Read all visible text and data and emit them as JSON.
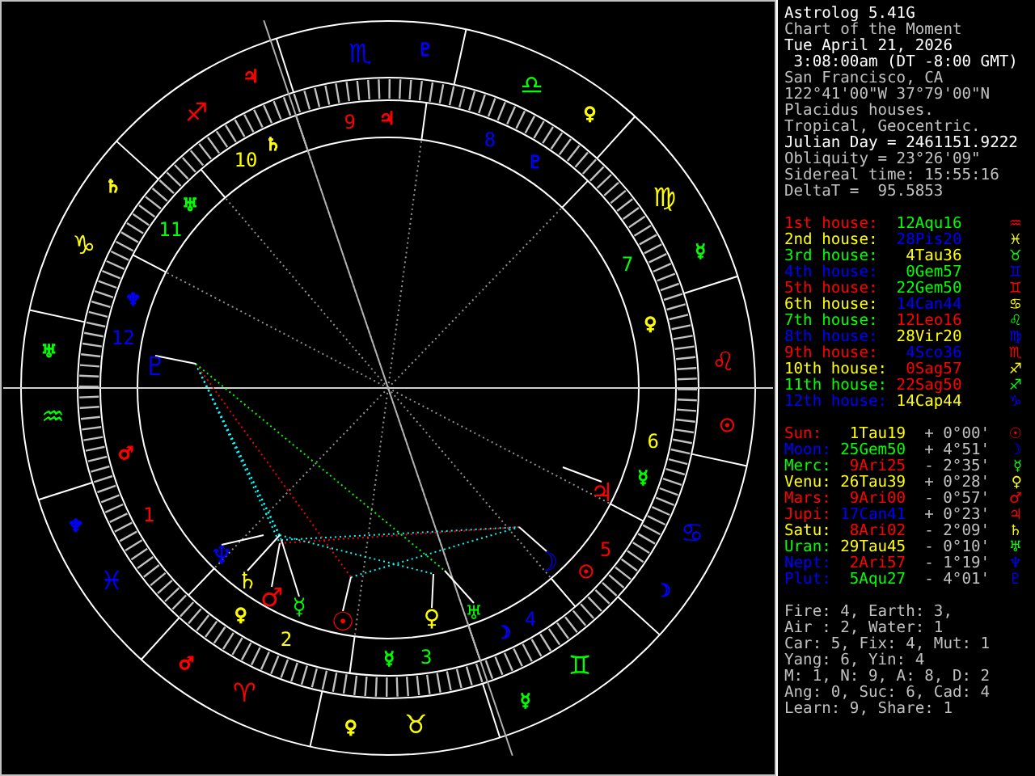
{
  "chart": {
    "signs": [
      {
        "glyph": "♈",
        "color": "#ff0000",
        "ruler": {
          "glyph": "♂",
          "color": "#ff0000"
        }
      },
      {
        "glyph": "♉",
        "color": "#ffff00",
        "ruler": {
          "glyph": "♀",
          "color": "#ffff00"
        }
      },
      {
        "glyph": "♊",
        "color": "#00ff00",
        "ruler": {
          "glyph": "☿",
          "color": "#00ff00"
        }
      },
      {
        "glyph": "♋",
        "color": "#0000ff",
        "ruler": {
          "glyph": "☽",
          "color": "#0000ff"
        }
      },
      {
        "glyph": "♌",
        "color": "#ff0000",
        "ruler": {
          "glyph": "☉",
          "color": "#ff0000"
        }
      },
      {
        "glyph": "♍",
        "color": "#ffff00",
        "ruler": {
          "glyph": "☿",
          "color": "#00ff00"
        }
      },
      {
        "glyph": "♎",
        "color": "#00ff00",
        "ruler": {
          "glyph": "♀",
          "color": "#ffff00"
        }
      },
      {
        "glyph": "♏",
        "color": "#0000ff",
        "ruler": {
          "glyph": "♇",
          "color": "#0000ff"
        }
      },
      {
        "glyph": "♐",
        "color": "#ff0000",
        "ruler": {
          "glyph": "♃",
          "color": "#ff0000"
        }
      },
      {
        "glyph": "♑",
        "color": "#ffff00",
        "ruler": {
          "glyph": "♄",
          "color": "#ffff00"
        }
      },
      {
        "glyph": "♒",
        "color": "#00ff00",
        "ruler": {
          "glyph": "♅",
          "color": "#00ff00"
        }
      },
      {
        "glyph": "♓",
        "color": "#0000ff",
        "ruler": {
          "glyph": "♆",
          "color": "#0000ff"
        }
      }
    ],
    "houses": [
      {
        "label": "1",
        "color": "#ff0000",
        "ruler": {
          "glyph": "♂",
          "color": "#ff0000"
        }
      },
      {
        "label": "2",
        "color": "#ffff00",
        "ruler": {
          "glyph": "♀",
          "color": "#ffff00"
        }
      },
      {
        "label": "3",
        "color": "#00ff00",
        "ruler": {
          "glyph": "☿",
          "color": "#00ff00"
        }
      },
      {
        "label": "4",
        "color": "#0000ff",
        "ruler": {
          "glyph": "☽",
          "color": "#0000ff"
        }
      },
      {
        "label": "5",
        "color": "#ff0000",
        "ruler": {
          "glyph": "☉",
          "color": "#ff0000"
        }
      },
      {
        "label": "6",
        "color": "#ffff00",
        "ruler": {
          "glyph": "☿",
          "color": "#00ff00"
        }
      },
      {
        "label": "7",
        "color": "#00ff00",
        "ruler": {
          "glyph": "♀",
          "color": "#ffff00"
        }
      },
      {
        "label": "8",
        "color": "#0000ff",
        "ruler": {
          "glyph": "♇",
          "color": "#0000ff"
        }
      },
      {
        "label": "9",
        "color": "#ff0000",
        "ruler": {
          "glyph": "♃",
          "color": "#ff0000"
        }
      },
      {
        "label": "10",
        "color": "#ffff00",
        "ruler": {
          "glyph": "♄",
          "color": "#ffff00"
        }
      },
      {
        "label": "11",
        "color": "#00ff00",
        "ruler": {
          "glyph": "♅",
          "color": "#00ff00"
        }
      },
      {
        "label": "12",
        "color": "#0000ff",
        "ruler": {
          "glyph": "♆",
          "color": "#0000ff"
        }
      }
    ],
    "planets": [
      {
        "glyph": "☉",
        "color": "#ff0000"
      },
      {
        "glyph": "☽",
        "color": "#0000ff"
      },
      {
        "glyph": "☿",
        "color": "#00ff00"
      },
      {
        "glyph": "♀",
        "color": "#ffff00"
      },
      {
        "glyph": "♂",
        "color": "#ff0000"
      },
      {
        "glyph": "♃",
        "color": "#ff0000"
      },
      {
        "glyph": "♄",
        "color": "#ffff00"
      },
      {
        "glyph": "♅",
        "color": "#00ff00"
      },
      {
        "glyph": "♆",
        "color": "#0000ff"
      },
      {
        "glyph": "♇",
        "color": "#0000ff"
      }
    ]
  },
  "info": [
    {
      "text": "Astrolog 5.41G",
      "bright": true
    },
    {
      "text": "Chart of the Moment",
      "bright": false
    },
    {
      "text": "Tue April 21, 2026",
      "bright": true
    },
    {
      "text": " 3:08:00am (DT -8:00 GMT)",
      "bright": true
    },
    {
      "text": "San Francisco, CA",
      "bright": false
    },
    {
      "text": "122°41'00\"W 37°79'00\"N",
      "bright": false
    },
    {
      "text": "Placidus houses.",
      "bright": false
    },
    {
      "text": "Tropical, Geocentric.",
      "bright": false
    },
    {
      "text": "Julian Day = 2461151.9222",
      "bright": true
    },
    {
      "text": "Obliquity = 23°26'09\"",
      "bright": false
    },
    {
      "text": "Sidereal time: 15:55:16",
      "bright": false
    },
    {
      "text": "DeltaT =  95.5853",
      "bright": false
    }
  ],
  "house_cusps": [
    {
      "label": "1st house:",
      "color": "#ff0000",
      "position": {
        "text": "12Aqu16",
        "color": "#00ff00"
      },
      "glyph": "♒"
    },
    {
      "label": "2nd house:",
      "color": "#ffff00",
      "position": {
        "text": "28Pis20",
        "color": "#0000ff"
      },
      "glyph": "♓"
    },
    {
      "label": "3rd house:",
      "color": "#00ff00",
      "position": {
        "text": "4Tau36",
        "color": "#ffff00"
      },
      "glyph": "♉"
    },
    {
      "label": "4th house:",
      "color": "#0000ff",
      "position": {
        "text": "0Gem57",
        "color": "#00ff00"
      },
      "glyph": "♊"
    },
    {
      "label": "5th house:",
      "color": "#ff0000",
      "position": {
        "text": "22Gem50",
        "color": "#00ff00"
      },
      "glyph": "♊"
    },
    {
      "label": "6th house:",
      "color": "#ffff00",
      "position": {
        "text": "14Can44",
        "color": "#0000ff"
      },
      "glyph": "♋"
    },
    {
      "label": "7th house:",
      "color": "#00ff00",
      "position": {
        "text": "12Leo16",
        "color": "#ff0000"
      },
      "glyph": "♌"
    },
    {
      "label": "8th house:",
      "color": "#0000ff",
      "position": {
        "text": "28Vir20",
        "color": "#ffff00"
      },
      "glyph": "♍"
    },
    {
      "label": "9th house:",
      "color": "#ff0000",
      "position": {
        "text": "4Sco36",
        "color": "#0000ff"
      },
      "glyph": "♏"
    },
    {
      "label": "10th house:",
      "color": "#ffff00",
      "position": {
        "text": "0Sag57",
        "color": "#ff0000"
      },
      "glyph": "♐"
    },
    {
      "label": "11th house:",
      "color": "#00ff00",
      "position": {
        "text": "22Sag50",
        "color": "#ff0000"
      },
      "glyph": "♐"
    },
    {
      "label": "12th house:",
      "color": "#0000ff",
      "position": {
        "text": "14Cap44",
        "color": "#ffff00"
      },
      "glyph": "♑"
    }
  ],
  "planet_positions": [
    {
      "name": "Sun:",
      "color": "#ff0000",
      "position": {
        "text": "1Tau19",
        "color": "#ffff00"
      },
      "latitude": "+ 0°00'",
      "glyph": "☉"
    },
    {
      "name": "Moon:",
      "color": "#0000ff",
      "position": {
        "text": "25Gem50",
        "color": "#00ff00"
      },
      "latitude": "+ 4°51'",
      "glyph": "☽"
    },
    {
      "name": "Merc:",
      "color": "#00ff00",
      "position": {
        "text": "9Ari25",
        "color": "#ff0000"
      },
      "latitude": "- 2°35'",
      "glyph": "☿"
    },
    {
      "name": "Venu:",
      "color": "#ffff00",
      "position": {
        "text": "26Tau39",
        "color": "#ffff00"
      },
      "latitude": "+ 0°28'",
      "glyph": "♀"
    },
    {
      "name": "Mars:",
      "color": "#ff0000",
      "position": {
        "text": "9Ari00",
        "color": "#ff0000"
      },
      "latitude": "- 0°57'",
      "glyph": "♂"
    },
    {
      "name": "Jupi:",
      "color": "#ff0000",
      "position": {
        "text": "17Can41",
        "color": "#0000ff"
      },
      "latitude": "+ 0°23'",
      "glyph": "♃"
    },
    {
      "name": "Satu:",
      "color": "#ffff00",
      "position": {
        "text": "8Ari02",
        "color": "#ff0000"
      },
      "latitude": "- 2°09'",
      "glyph": "♄"
    },
    {
      "name": "Uran:",
      "color": "#00ff00",
      "position": {
        "text": "29Tau45",
        "color": "#ffff00"
      },
      "latitude": "- 0°10'",
      "glyph": "♅"
    },
    {
      "name": "Nept:",
      "color": "#0000ff",
      "position": {
        "text": "2Ari57",
        "color": "#ff0000"
      },
      "latitude": "- 1°19'",
      "glyph": "♆"
    },
    {
      "name": "Plut:",
      "color": "#0000ff",
      "position": {
        "text": "5Aqu27",
        "color": "#00ff00"
      },
      "latitude": "- 4°01'",
      "glyph": "♇"
    }
  ],
  "summary": [
    "Fire: 4, Earth: 3,",
    "Air : 2, Water: 1",
    "Car: 5, Fix: 4, Mut: 1",
    "Yang: 6, Yin: 4",
    "M: 1, N: 9, A: 8, D: 2",
    "Ang: 0, Suc: 6, Cad: 4",
    "Learn: 9, Share: 1"
  ]
}
